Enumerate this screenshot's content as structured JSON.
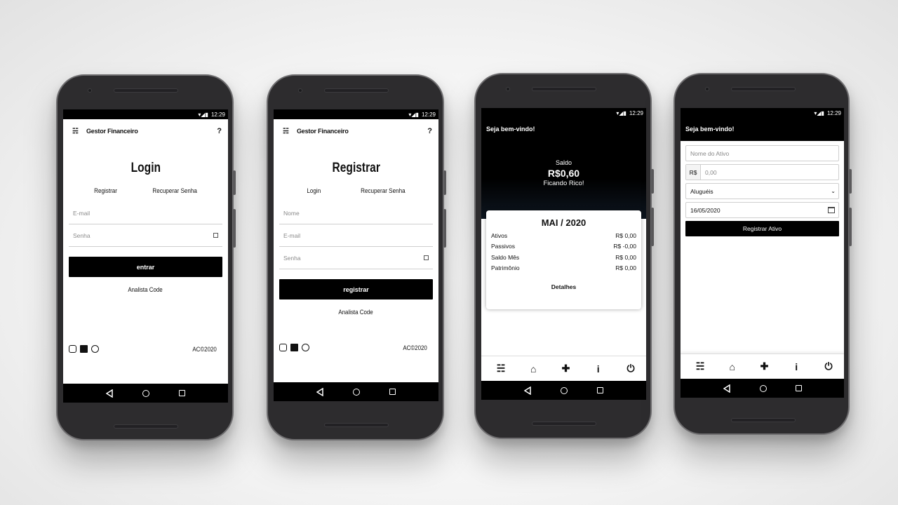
{
  "status": {
    "time": "12:29"
  },
  "screen_login": {
    "app_title": "Gestor Financeiro",
    "help": "?",
    "title": "Login",
    "link_left": "Registrar",
    "link_right": "Recuperar Senha",
    "email_placeholder": "E-mail",
    "password_placeholder": "Senha",
    "button": "entrar",
    "credit": "Analista Code",
    "copyright": "AC©2020"
  },
  "screen_register": {
    "app_title": "Gestor Financeiro",
    "help": "?",
    "title": "Registrar",
    "link_left": "Login",
    "link_right": "Recuperar Senha",
    "name_placeholder": "Nome",
    "email_placeholder": "E-mail",
    "password_placeholder": "Senha",
    "button": "registrar",
    "credit": "Analista Code",
    "copyright": "AC©2020"
  },
  "screen_dashboard": {
    "welcome": "Seja bem-vindo!",
    "saldo_label": "Saldo",
    "saldo_value": "R$0,60",
    "saldo_sub": "Ficando Rico!",
    "card": {
      "title": "MAI / 2020",
      "rows": [
        {
          "label": "Ativos",
          "value": "R$ 0,00"
        },
        {
          "label": "Passivos",
          "value": "R$ -0,00"
        },
        {
          "label": "Saldo Mês",
          "value": "R$ 0,00"
        },
        {
          "label": "Patrimônio",
          "value": "R$ 0,00"
        }
      ],
      "details": "Detalhes"
    }
  },
  "screen_form": {
    "welcome": "Seja bem-vindo!",
    "name_placeholder": "Nome do Ativo",
    "currency_prefix": "R$",
    "amount_placeholder": "0,00",
    "category_value": "Aluguéis",
    "date_value": "16/05/2020",
    "button": "Registrar Ativo"
  },
  "tabbar_icons": [
    "menu-icon",
    "home-icon",
    "plus-icon",
    "info-icon",
    "power-icon"
  ]
}
